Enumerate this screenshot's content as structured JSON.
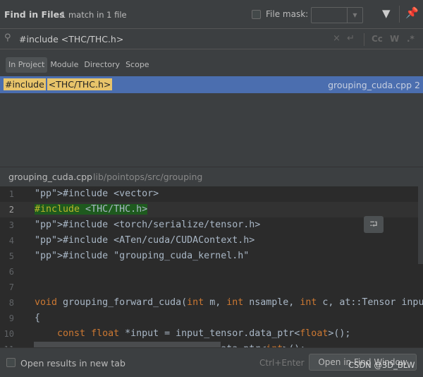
{
  "header": {
    "title": "Find in Files",
    "count": "1 match in 1 file",
    "file_mask_label": "File mask:",
    "file_mask_value": "",
    "filter_icon": "filter-icon",
    "pin_icon": "pin-icon"
  },
  "search": {
    "query": "#include <THC/THC.h>",
    "options": [
      "Cc",
      "W",
      ".*"
    ]
  },
  "scope": {
    "tabs": [
      "In Project",
      "Module",
      "Directory",
      "Scope"
    ],
    "selected": "In Project"
  },
  "results": [
    {
      "match_a": "#include",
      "match_b": "<THC/THC.h>",
      "file": "grouping_cuda.cpp",
      "line": "2"
    }
  ],
  "preview": {
    "file": "grouping_cuda.cpp",
    "path": "lib/pointops/src/grouping",
    "lines": [
      {
        "n": "1",
        "text": "#include <vector>"
      },
      {
        "n": "2",
        "text": "#include <THC/THC.h>"
      },
      {
        "n": "3",
        "text": "#include <torch/serialize/tensor.h>"
      },
      {
        "n": "4",
        "text": "#include <ATen/cuda/CUDAContext.h>"
      },
      {
        "n": "5",
        "text": "#include \"grouping_cuda_kernel.h\""
      },
      {
        "n": "6",
        "text": ""
      },
      {
        "n": "7",
        "text": ""
      },
      {
        "n": "8",
        "text": "void grouping_forward_cuda(int m, int nsample, int c, at::Tensor input_tensor"
      },
      {
        "n": "9",
        "text": "{"
      },
      {
        "n": "10",
        "text": "    const float *input = input_tensor.data_ptr<float>();"
      },
      {
        "n": "11",
        "text": "    const int *idx = idx_tensor.data_ptr<int>();"
      }
    ]
  },
  "footer": {
    "new_tab_label": "Open results in new tab",
    "shortcut": "Ctrl+Enter",
    "open_button": "Open in Find Window"
  },
  "watermark": "CSDN @3D_BLW",
  "colors": {
    "selection": "#4b6eaf",
    "match_highlight": "#e8c46a",
    "keyword": "#cc7832",
    "string": "#6a8759"
  }
}
